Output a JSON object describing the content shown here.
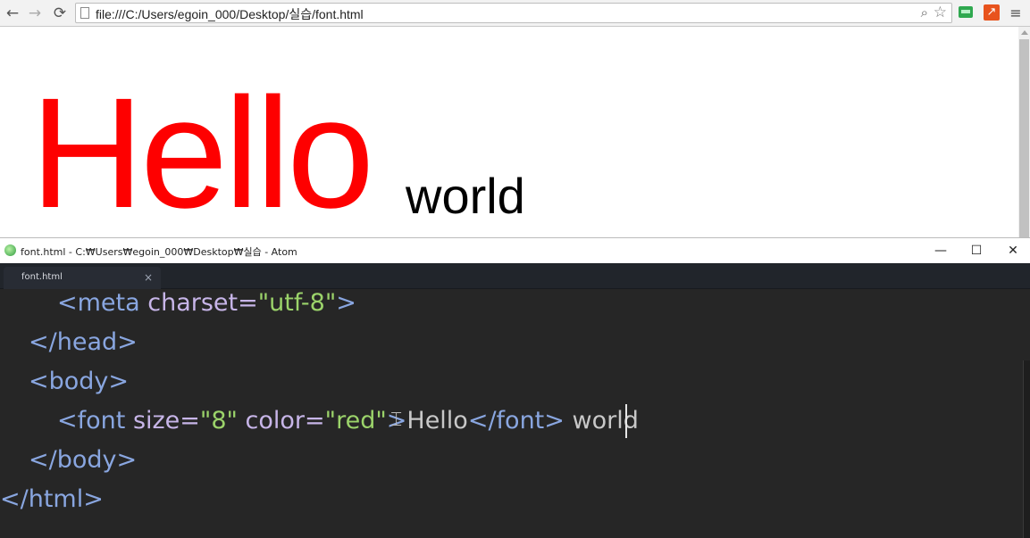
{
  "browser": {
    "nav": {
      "back": "←",
      "forward": "→",
      "reload": "⟳"
    },
    "url": "file:///C:/Users/egoin_000/Desktop/실습/font.html",
    "icons": {
      "zoom": "magnifier-icon",
      "star": "star-icon",
      "menu": "hamburger-menu-icon"
    },
    "menu_glyph": "≡",
    "ext2_glyph": "↗"
  },
  "page": {
    "hello": "Hello",
    "world": "world",
    "hello_color": "#fe0000"
  },
  "atom": {
    "window_title": "font.html - C:₩Users₩egoin_000₩Desktop₩실습 - Atom",
    "minimize": "—",
    "maximize": "☐",
    "close": "✕",
    "tab_title": "font.html",
    "tab_close": "×",
    "code": {
      "l1_open": "<",
      "l1_tag": "meta",
      "l1_attr": " charset=",
      "l1_str": "\"utf-8\"",
      "l1_close": ">",
      "l2": "</head>",
      "l3": "<body>",
      "l4_open": "<font",
      "l4_attr1": " size=",
      "l4_str1": "\"8\"",
      "l4_attr2": " color=",
      "l4_str2": "\"red\"",
      "l4_close": ">",
      "l4_text1": "Hello",
      "l4_endtag": "</font>",
      "l4_text2": " world",
      "l5": "</body>",
      "l6": "</html>"
    }
  }
}
